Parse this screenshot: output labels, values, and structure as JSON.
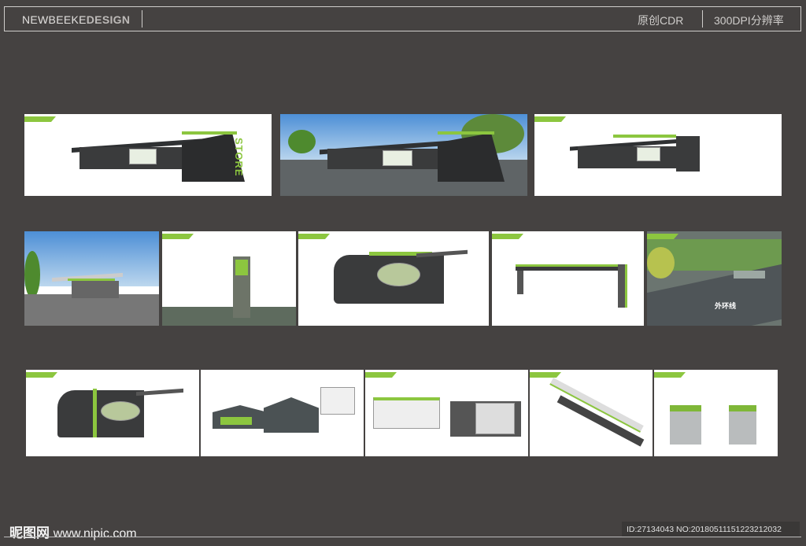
{
  "header": {
    "brand_light": "NEWBEEKE",
    "brand_bold": "DESIGN",
    "format": "原创CDR",
    "resolution": "300DPI分辨率"
  },
  "panels": {
    "store_text": "STORE",
    "outer_ring_label": "外环线"
  },
  "footer": {
    "site_logo": "昵图网",
    "site_url": "www.nipic.com",
    "id_text": "ID:27134043 NO:20180511151223212032"
  },
  "colors": {
    "background": "#454241",
    "accent": "#8cc63f"
  }
}
